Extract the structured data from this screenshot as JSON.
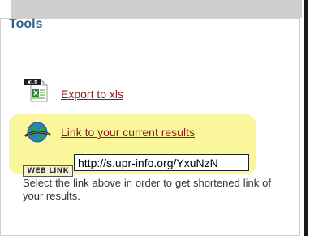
{
  "panel": {
    "title": "Tools"
  },
  "export": {
    "badge": "XLS",
    "label": "Export to xls",
    "icon": "excel-file-icon"
  },
  "share": {
    "label": "Link to your current results",
    "icon": "globe-link-icon",
    "badge": "WEB LINK",
    "url_value": "http://s.upr-info.org/YxuNzN",
    "hint": "Select the link above in order to get shortened link of your results."
  },
  "colors": {
    "title": "#2e5e8e",
    "link": "#8b1a1a",
    "highlight": "#faf69b"
  }
}
